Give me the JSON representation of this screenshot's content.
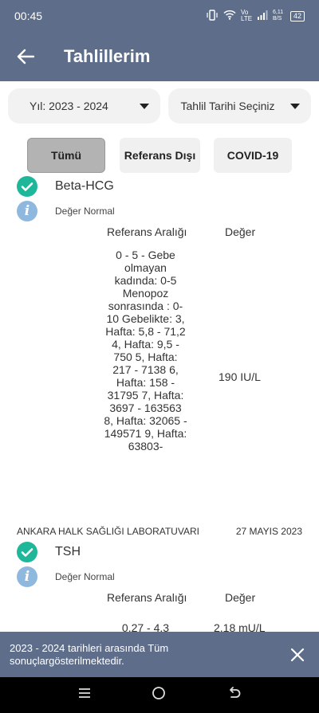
{
  "status_bar": {
    "time": "00:45",
    "network": "Vo LTE",
    "speed": "6,11 B/S",
    "battery": "42"
  },
  "app_bar": {
    "title": "Tahlillerim"
  },
  "filters": {
    "year": "Yıl: 2023 - 2024",
    "date": "Tahlil Tarihi Seçiniz"
  },
  "tabs": [
    {
      "label": "Tümü",
      "active": true
    },
    {
      "label": "Referans Dışı",
      "active": false
    },
    {
      "label": "COVID-19",
      "active": false
    }
  ],
  "results": [
    {
      "name": "Beta-HCG",
      "status": "Değer Normal",
      "ref_header": "Referans Aralığı",
      "value_header": "Değer",
      "range": "0 - 5 - Gebe olmayan kadında: 0-5 Menopoz sonrasında : 0-10 Gebelikte: 3, Hafta: 5,8 - 71,2 4, Hafta: 9,5 - 750 5, Hafta: 217 - 7138 6, Hafta: 158 - 31795 7, Hafta: 3697 - 163563 8, Hafta: 32065 - 149571 9, Hafta: 63803-",
      "value": "190 IU/L"
    },
    {
      "lab": "ANKARA HALK SAĞLIĞI LABORATUVARI",
      "date": "27 MAYIS 2023",
      "name": "TSH",
      "status": "Değer Normal",
      "ref_header": "Referans Aralığı",
      "value_header": "Değer",
      "range": "0.27 - 4.3",
      "value": "2.18 mU/L"
    }
  ],
  "snackbar": {
    "message": "2023 - 2024 tarihleri arasında Tüm sonuçlargösterilmektedir."
  },
  "colors": {
    "primary": "#5d6d8a",
    "check": "#1fb79a",
    "info": "#8fb8df"
  }
}
